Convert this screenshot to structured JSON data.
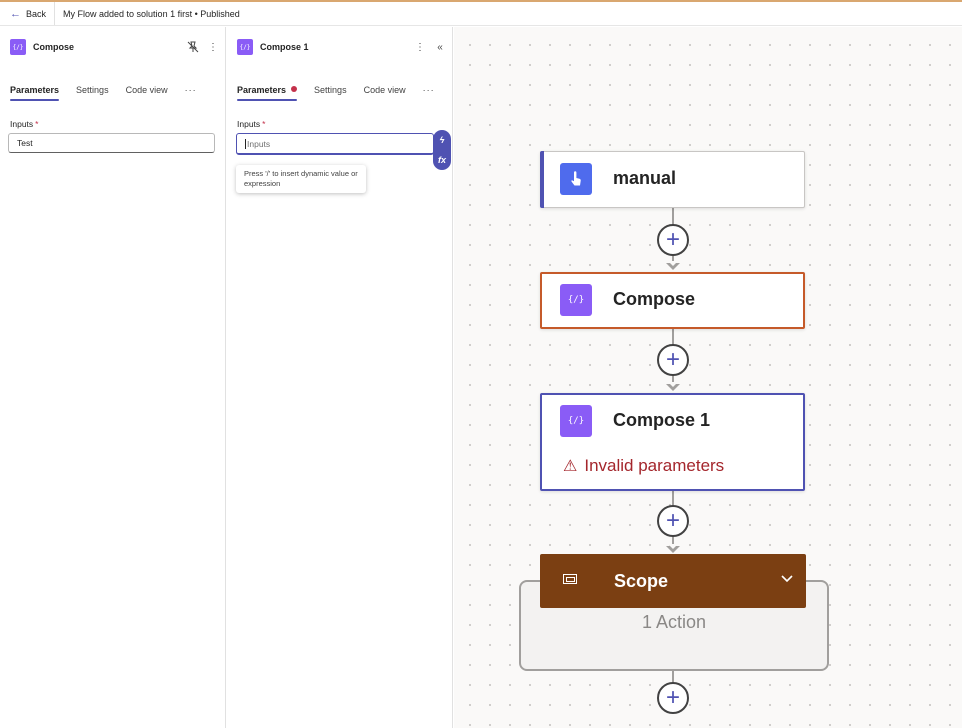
{
  "topbar": {
    "back_label": "Back",
    "flow_title": "My Flow added to solution 1 first • Published"
  },
  "panel_compose": {
    "icon": "{/}",
    "title": "Compose",
    "tabs": [
      "Parameters",
      "Settings",
      "Code view"
    ],
    "more": "···",
    "inputs_label": "Inputs",
    "required": "*",
    "inputs_value": "Test"
  },
  "panel_compose1": {
    "icon": "{/}",
    "title": "Compose 1",
    "tabs": [
      "Parameters",
      "Settings",
      "Code view"
    ],
    "more": "···",
    "inputs_label": "Inputs",
    "required": "*",
    "inputs_placeholder": "Inputs",
    "tooltip": "Press '/' to insert dynamic value or expression",
    "tool_dynamic": "ϟ",
    "tool_fx": "fx"
  },
  "canvas": {
    "nodes": [
      {
        "title": "manual",
        "icon": "trigger-hand-icon",
        "icon_color": "#4f6bed"
      },
      {
        "title": "Compose",
        "icon": "compose-icon",
        "icon_color": "#8a5cf6",
        "border": "#c55a2a"
      },
      {
        "title": "Compose 1",
        "icon": "compose-icon",
        "icon_color": "#8a5cf6",
        "border": "#4f52b2",
        "warning": "Invalid parameters"
      }
    ],
    "scope": {
      "title": "Scope",
      "count": "1 Action",
      "color": "#7b3f12"
    },
    "plus": "+"
  },
  "colors": {
    "accent": "#4f52b2",
    "error": "#a4262c",
    "compose": "#8a5cf6"
  }
}
